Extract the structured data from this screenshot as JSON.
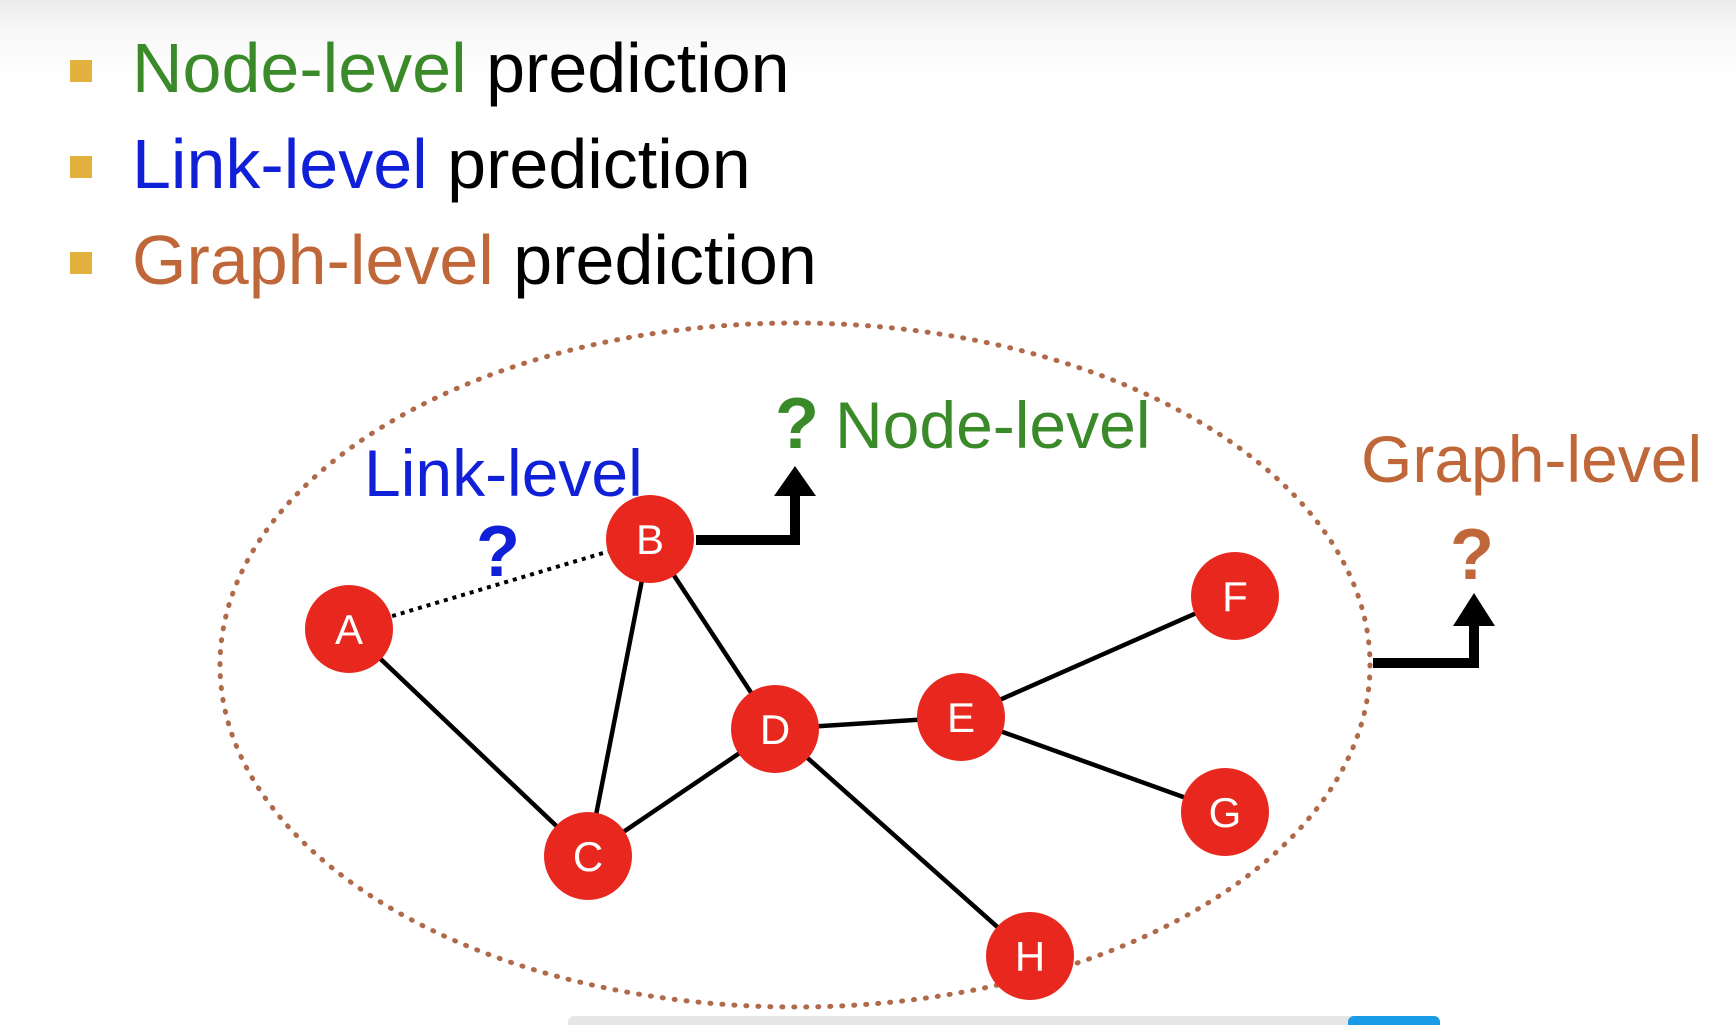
{
  "colors": {
    "node_level": "#3a8a2a",
    "link_level": "#1020d8",
    "graph_level": "#c0673a",
    "bullet": "#e3b13e",
    "node_fill": "#e8281e",
    "ellipse": "#b06a4a"
  },
  "bullets": [
    {
      "prefix": "Node-level",
      "suffix": " prediction",
      "color_key": "node_level"
    },
    {
      "prefix": "Link-level",
      "suffix": " prediction",
      "color_key": "link_level"
    },
    {
      "prefix": "Graph-level",
      "suffix": " prediction",
      "color_key": "graph_level"
    }
  ],
  "annotations": {
    "link_label": "Link-level",
    "link_q": "?",
    "node_label": "Node-level",
    "node_q": "?",
    "graph_label": "Graph-level",
    "graph_q": "?"
  },
  "nodes": [
    {
      "id": "A",
      "label": "A"
    },
    {
      "id": "B",
      "label": "B"
    },
    {
      "id": "C",
      "label": "C"
    },
    {
      "id": "D",
      "label": "D"
    },
    {
      "id": "E",
      "label": "E"
    },
    {
      "id": "F",
      "label": "F"
    },
    {
      "id": "G",
      "label": "G"
    },
    {
      "id": "H",
      "label": "H"
    }
  ],
  "edges": [
    {
      "from": "A",
      "to": "C",
      "style": "solid"
    },
    {
      "from": "B",
      "to": "C",
      "style": "solid"
    },
    {
      "from": "B",
      "to": "D",
      "style": "solid"
    },
    {
      "from": "C",
      "to": "D",
      "style": "solid"
    },
    {
      "from": "D",
      "to": "E",
      "style": "solid"
    },
    {
      "from": "D",
      "to": "H",
      "style": "solid"
    },
    {
      "from": "E",
      "to": "F",
      "style": "solid"
    },
    {
      "from": "E",
      "to": "G",
      "style": "solid"
    },
    {
      "from": "A",
      "to": "B",
      "style": "dotted"
    }
  ]
}
